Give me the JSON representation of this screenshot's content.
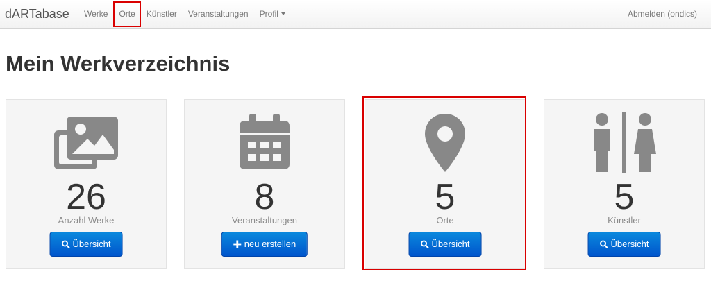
{
  "navbar": {
    "brand": "dARTabase",
    "items": [
      {
        "label": "Werke"
      },
      {
        "label": "Orte",
        "highlighted": true
      },
      {
        "label": "Künstler"
      },
      {
        "label": "Veranstaltungen"
      },
      {
        "label": "Profil"
      }
    ],
    "logout": "Abmelden (ondics)"
  },
  "page_title": "Mein Werkverzeichnis",
  "cards": [
    {
      "icon": "images-icon",
      "count": "26",
      "label": "Anzahl Werke",
      "button": "Übersicht",
      "button_icon": "search-icon"
    },
    {
      "icon": "calendar-icon",
      "count": "8",
      "label": "Veranstaltungen",
      "button": "neu erstellen",
      "button_icon": "plus-icon"
    },
    {
      "icon": "map-marker-icon",
      "count": "5",
      "label": "Orte",
      "button": "Übersicht",
      "button_icon": "search-icon",
      "highlighted": true
    },
    {
      "icon": "restroom-icon",
      "count": "5",
      "label": "Künstler",
      "button": "Übersicht",
      "button_icon": "search-icon"
    }
  ],
  "colors": {
    "accent": "#0063d1",
    "highlight": "#d90000",
    "icon": "#888888",
    "card_bg": "#f5f5f5"
  }
}
